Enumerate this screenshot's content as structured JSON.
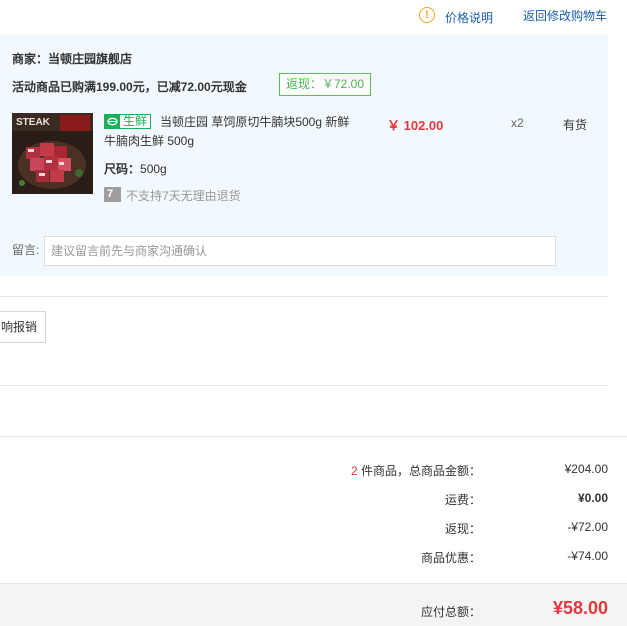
{
  "top_links": {
    "price_info": "价格说明",
    "back_to_cart": "返回修改购物车"
  },
  "shop": {
    "name": "商家：当顿庄园旗舰店",
    "promotion": "活动商品已购满199.00元，已减72.00元现金",
    "cashback_badge": "返现：￥72.00"
  },
  "product": {
    "tag": "生鲜",
    "title": "当顿庄园 草饲原切牛腩块500g 新鲜牛腩肉生鲜 500g",
    "image_text": "STEAK",
    "size_label": "尺码：",
    "size_value": "500g",
    "no_return_icon": "7",
    "no_return_text": "不支持7天无理由退货",
    "price": "￥ 102.00",
    "quantity": "x2",
    "stock": "有货"
  },
  "note": {
    "label": "留言:",
    "placeholder": "建议留言前先与商家沟通确认"
  },
  "invoice": {
    "button_label": "响报销"
  },
  "summary": {
    "item_count": "2",
    "items_label": " 件商品，总商品金额：",
    "items_total": "¥204.00",
    "shipping_label": "运费：",
    "shipping": "¥0.00",
    "cashback_label": "返现：",
    "cashback": "-¥72.00",
    "discount_label": "商品优惠：",
    "discount": "-¥74.00"
  },
  "total": {
    "label": "应付总额：",
    "value": "¥58.00"
  },
  "colors": {
    "panel_bg": "#f2f9fe",
    "price_red": "#e4393c",
    "link_blue": "#1a5fb4",
    "fresh_green": "#19b05a",
    "badge_green": "#4caf50",
    "info_orange": "#f0a81b"
  },
  "icons": {
    "price_info": "info-circle-icon",
    "fresh": "leaf-icon",
    "no_return": "seven-day-return-icon"
  }
}
